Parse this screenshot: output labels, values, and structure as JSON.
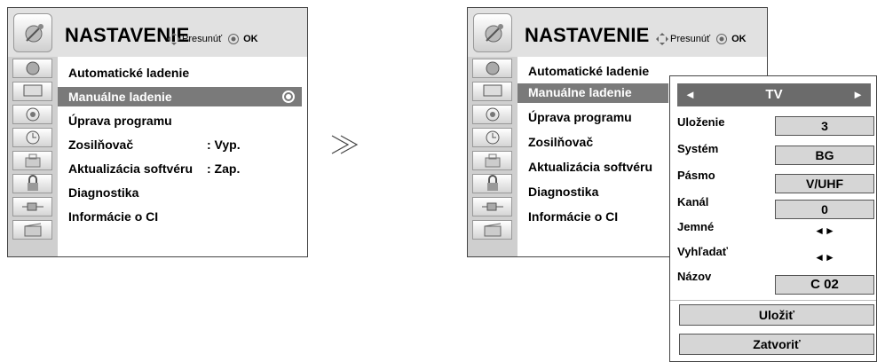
{
  "left_menu": {
    "title": "NASTAVENIE",
    "hint_label": "Presunúť",
    "ok_label": "OK",
    "items": [
      {
        "label": "Automatické ladenie",
        "value": ""
      },
      {
        "label": "Manuálne ladenie",
        "value": ""
      },
      {
        "label": "Úprava programu",
        "value": ""
      },
      {
        "label": "Zosilňovač",
        "value": ": Vyp."
      },
      {
        "label": "Aktualizácia softvéru",
        "value": ": Zap."
      },
      {
        "label": "Diagnostika",
        "value": ""
      },
      {
        "label": "Informácie o CI",
        "value": ""
      }
    ],
    "icons": [
      "satellite-icon",
      "monitor-icon",
      "speaker-icon",
      "clock-icon",
      "lock-icon",
      "padlock-icon",
      "plug-icon",
      "clapper-icon"
    ]
  },
  "arrow_symbol": "≫",
  "right_menu": {
    "title": "NASTAVENIE",
    "hint_label": "Presunúť",
    "ok_label": "OK",
    "items": [
      {
        "label": "Automatické ladenie"
      },
      {
        "label": "Manuálne ladenie"
      },
      {
        "label": "Úprava programu"
      },
      {
        "label": "Zosilňovač"
      },
      {
        "label": "Aktualizácia softvéru"
      },
      {
        "label": "Diagnostika"
      },
      {
        "label": "Informácie o CI"
      }
    ]
  },
  "submenu": {
    "source": "TV",
    "left_arrow": "◄",
    "right_arrow": "►",
    "fields": [
      {
        "label": "Uloženie",
        "value": "3"
      },
      {
        "label": "Systém",
        "value": "BG"
      },
      {
        "label": "Pásmo",
        "value": "V/UHF"
      },
      {
        "label": "Kanál",
        "value": "0"
      },
      {
        "label": "Jemné",
        "value": "◄►"
      },
      {
        "label": "Vyhľadať",
        "value": "◄►"
      },
      {
        "label": "Názov",
        "value": "C  02"
      }
    ],
    "save_label": "Uložiť",
    "close_label": "Zatvoriť"
  },
  "colors": {
    "selection": "#7a7a7a",
    "header": "#e1e1e1",
    "icon_bar": "#cfcfcf",
    "value_box": "#d6d6d6"
  }
}
